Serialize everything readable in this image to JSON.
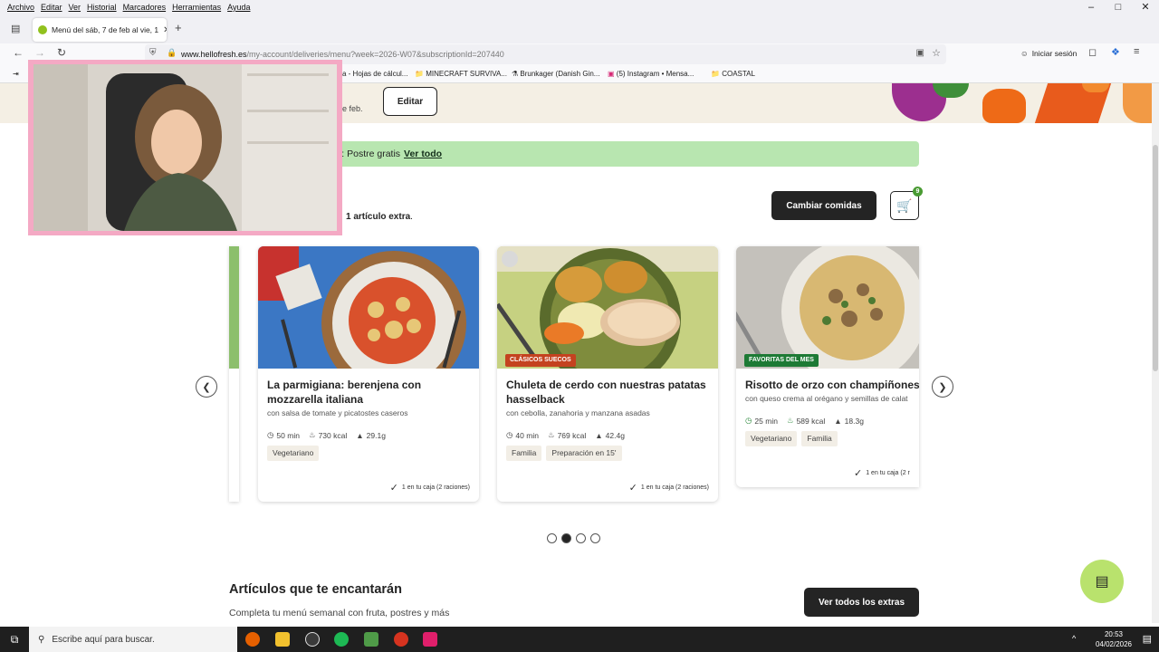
{
  "browser": {
    "menu": [
      "Archivo",
      "Editar",
      "Ver",
      "Historial",
      "Marcadores",
      "Herramientas",
      "Ayuda"
    ],
    "tab_title": "Menú del sáb, 7 de feb al vie, 1",
    "url_domain": "www.hellofresh.es",
    "url_path": "/my-account/deliveries/menu?week=2026-W07&subscriptionId=207440",
    "sign_in": "Iniciar sesión",
    "bookmarks": [
      "a - Hojas de cálcul...",
      "MINECRAFT SURVIVA...",
      "Brunkager (Danish Gin...",
      "(5) Instagram • Mensa...",
      "COASTAL"
    ]
  },
  "hero": {
    "text": "e feb.",
    "edit_label": "Editar"
  },
  "promo": {
    "text": "mana:  Postre gratis",
    "link": "Ver todo"
  },
  "extras": {
    "count_text": "1 artículo extra",
    "suffix": "."
  },
  "actions": {
    "change_meals": "Cambiar comidas",
    "cart_count": "9"
  },
  "cards": [
    {
      "title": "La parmigiana: berenjena con mozzarella italiana",
      "subtitle": "con salsa de tomate y picatostes caseros",
      "badge": "",
      "time": "50 min",
      "kcal": "730 kcal",
      "protein": "29.1g",
      "tags": [
        "Vegetariano"
      ],
      "inbox": "1 en tu caja (2 raciones)"
    },
    {
      "title": "Chuleta de cerdo con nuestras patatas hasselback",
      "subtitle": "con cebolla, zanahoria y manzana asadas",
      "badge": "CLÁSICOS SUECOS",
      "time": "40 min",
      "kcal": "769 kcal",
      "protein": "42.4g",
      "tags": [
        "Familia",
        "Preparación en 15'"
      ],
      "inbox": "1 en tu caja (2 raciones)"
    },
    {
      "title": "Risotto de orzo con champiñones",
      "subtitle": "con queso crema al orégano y semillas de calat",
      "badge": "FAVORITAS DEL MES",
      "time": "25 min",
      "kcal": "589 kcal",
      "protein": "18.3g",
      "tags": [
        "Vegetariano",
        "Familia"
      ],
      "inbox": "1 en tu caja (2 r"
    }
  ],
  "badge_colors": {
    "CLÁSICOS SUECOS": "#c4421f",
    "FAVORITAS DEL MES": "#1d7a35"
  },
  "carousel": {
    "pages": 4,
    "active": 2
  },
  "section": {
    "title": "Artículos que te encantarán",
    "subtitle": "Completa tu menú semanal con fruta, postres y más",
    "button": "Ver todos los extras"
  },
  "taskbar": {
    "search_placeholder": "Escribe aquí para buscar.",
    "time": "20:53",
    "date": "04/02/2026"
  }
}
